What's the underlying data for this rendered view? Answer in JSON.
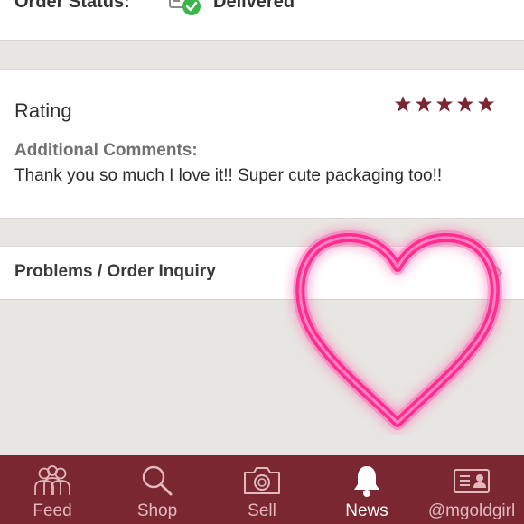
{
  "order": {
    "label": "Order Status:",
    "status_icon": "delivered-check-icon",
    "value": "Delivered"
  },
  "rating": {
    "label": "Rating",
    "stars": 5,
    "max_stars": 5,
    "star_color": "#7a2731",
    "comments_label": "Additional Comments:",
    "comments_text": "Thank you so much I love it!! Super cute packaging too!!"
  },
  "problems": {
    "label": "Problems / Order Inquiry",
    "icon": "chevron-right-icon"
  },
  "overlay": {
    "icon": "neon-heart-icon",
    "color": "#ff2d8f"
  },
  "tabbar": {
    "background": "#7a2731",
    "active_index": 3,
    "tabs": [
      {
        "label": "Feed",
        "icon": "people-icon"
      },
      {
        "label": "Shop",
        "icon": "search-icon"
      },
      {
        "label": "Sell",
        "icon": "camera-icon"
      },
      {
        "label": "News",
        "icon": "bell-icon"
      },
      {
        "label": "@mgoldgirl",
        "icon": "profile-card-icon"
      }
    ]
  }
}
